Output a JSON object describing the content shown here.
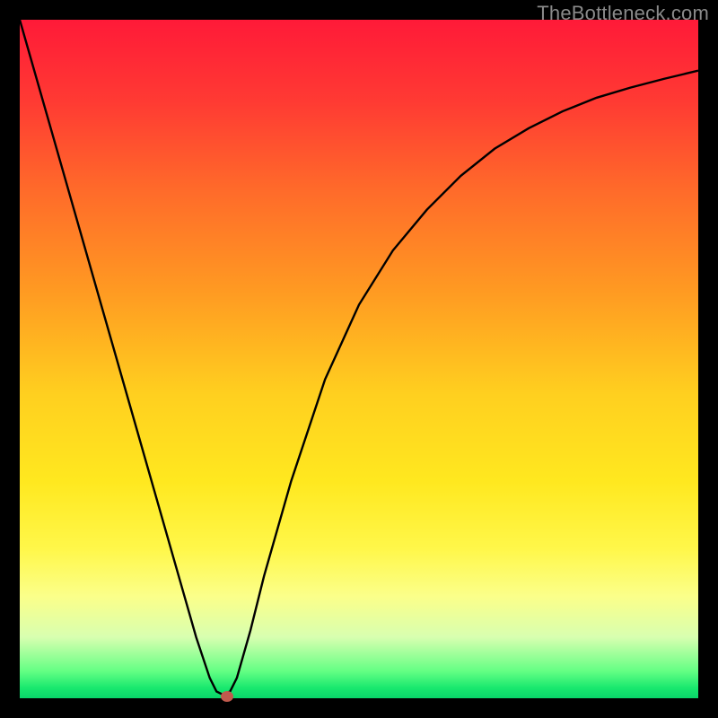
{
  "watermark": "TheBottleneck.com",
  "colors": {
    "frame": "#000000",
    "curve": "#000000",
    "marker": "#c05a4d"
  },
  "chart_data": {
    "type": "line",
    "title": "",
    "xlabel": "",
    "ylabel": "",
    "xlim": [
      0,
      100
    ],
    "ylim": [
      0,
      100
    ],
    "grid": false,
    "x": [
      0,
      4,
      8,
      12,
      16,
      20,
      24,
      26,
      28,
      29,
      30,
      31,
      32,
      34,
      36,
      40,
      45,
      50,
      55,
      60,
      65,
      70,
      75,
      80,
      85,
      90,
      95,
      100
    ],
    "values": [
      100,
      86,
      72,
      58,
      44,
      30,
      16,
      9,
      3,
      1,
      0.5,
      1,
      3,
      10,
      18,
      32,
      47,
      58,
      66,
      72,
      77,
      81,
      84,
      86.5,
      88.5,
      90,
      91.3,
      92.5
    ],
    "marker": {
      "x": 30.5,
      "y": 0.2
    },
    "note": "values are percent of vertical axis measured from the bottom; curve has a sharp minimum near x=30"
  }
}
